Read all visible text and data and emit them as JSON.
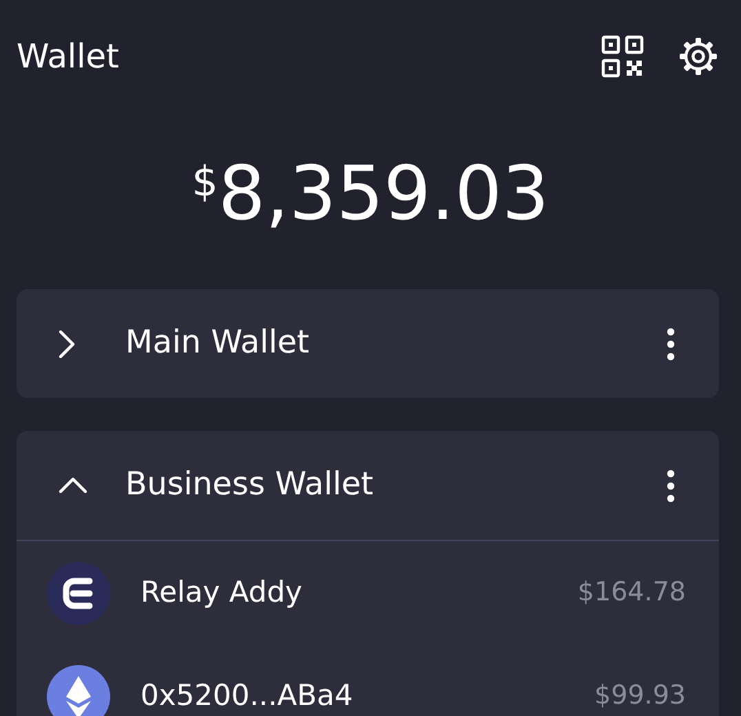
{
  "header": {
    "title": "Wallet"
  },
  "balance": {
    "currency": "$",
    "amount": "8,359.03"
  },
  "wallets": [
    {
      "name": "Main Wallet",
      "expanded": false
    },
    {
      "name": "Business Wallet",
      "expanded": true,
      "accounts": [
        {
          "kind": "enjin",
          "name": "Relay Addy",
          "value": "$164.78"
        },
        {
          "kind": "ether",
          "name": "0x5200...ABa4",
          "value": "$99.93"
        }
      ]
    }
  ]
}
